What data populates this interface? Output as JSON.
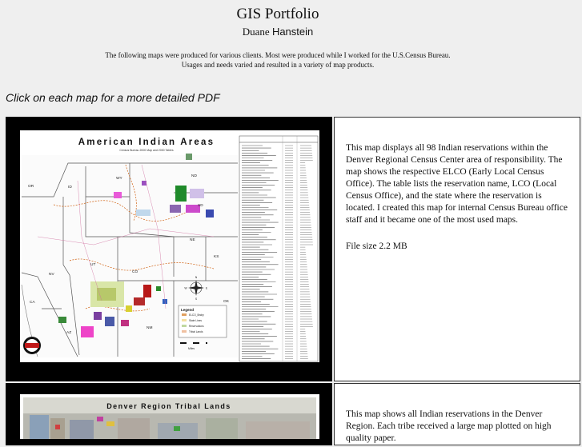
{
  "header": {
    "title": "GIS Portfolio",
    "author_first": "Duane",
    "author_last": "Hanstein",
    "intro_line1": "The following maps were produced for various clients. Most were produced while I worked for the U.S.Census Bureau.",
    "intro_line2": "Usages and needs varied and resulted in a variety of map products."
  },
  "instruction": "Click on each map for a more detailed PDF",
  "maps": [
    {
      "map_title": "American Indian Areas",
      "map_subtitle": "Census Bureau 2000 Map and 2000 Tables",
      "state_labels": [
        "OR",
        "ID",
        "WY",
        "ND",
        "SD",
        "NE",
        "UT",
        "CO",
        "KS",
        "NV",
        "CA",
        "AZ",
        "NM",
        "OK"
      ],
      "legend_title": "Legend",
      "legend_items": [
        "ELCO_Bndry",
        "State Lines",
        "Reservations",
        "Tribal Lands"
      ],
      "compass_letters": [
        "N",
        "S",
        "E",
        "W"
      ],
      "scale_label": "Miles",
      "description": "This map displays all 98 Indian reservations within the Denver Regional Census Center area of responsibility. The map shows the respective ELCO (Early Local Census Office). The table lists the reservation name, LCO (Local Census Office), and the state where the reservation is located.  I created this map for internal Census Bureau office staff and it became one of the most used maps.",
      "file_size": "File size 2.2 MB"
    },
    {
      "map_title": "Denver Region Tribal Lands",
      "description": "This map shows all Indian reservations in the Denver Region. Each tribe received a large map plotted on high quality paper."
    }
  ],
  "colors": {
    "page_bg": "#efefef",
    "map_frame": "#000000",
    "text_cell_bg": "#ffffff"
  }
}
